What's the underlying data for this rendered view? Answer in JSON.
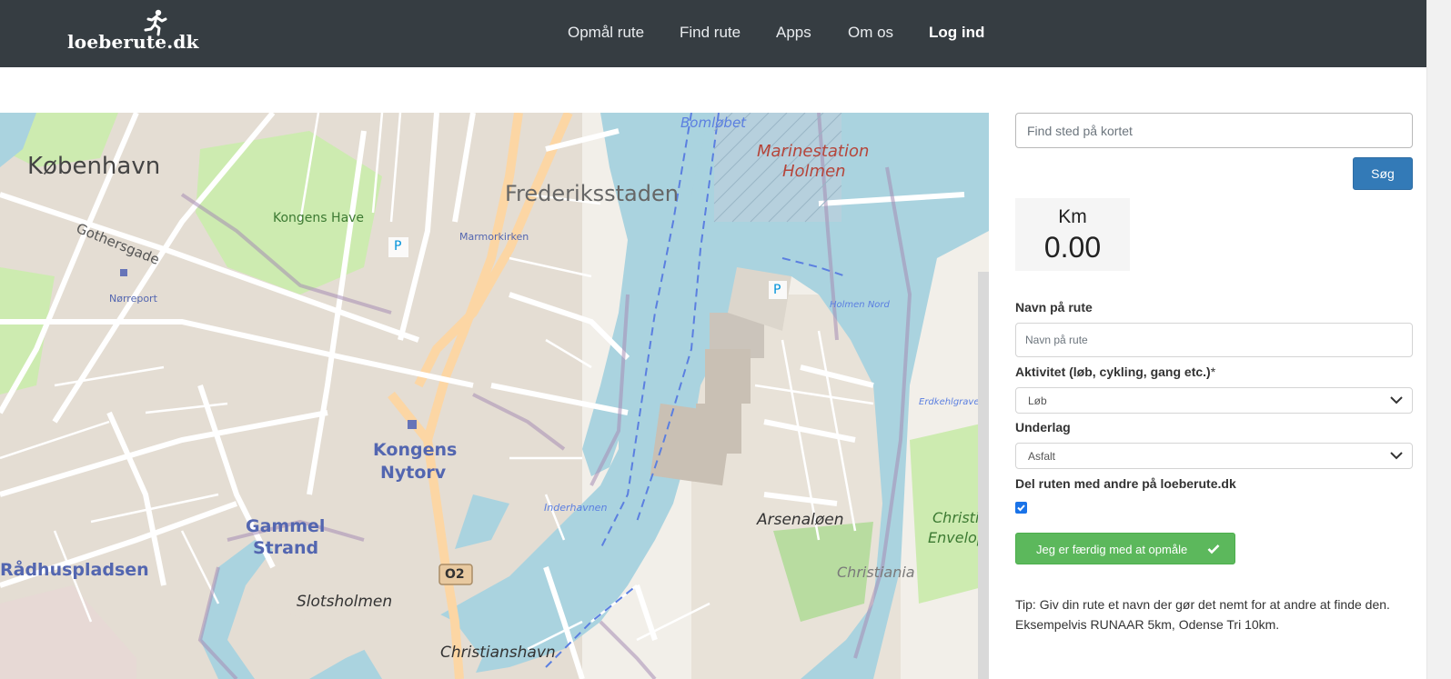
{
  "navbar": {
    "logo_text": "loeberute.dk",
    "logo_icon": "runner-icon",
    "items": [
      {
        "label": "Opmål rute"
      },
      {
        "label": "Find rute"
      },
      {
        "label": "Apps"
      },
      {
        "label": "Om os"
      },
      {
        "label": "Log ind"
      }
    ]
  },
  "map": {
    "labels": [
      "København",
      "Gothersgade",
      "Kongens Have",
      "Nørreport",
      "Marmorkirken",
      "Frederiksstaden",
      "Kongens",
      "Nytorv",
      "Gammel",
      "Strand",
      "Slotsholmen",
      "Christianshavn",
      "Rådhuspladsen",
      "Marinestation",
      "Holmen",
      "Bomløbet",
      "Arsenaløen",
      "Christiania",
      "Christiania",
      "Enveloppen",
      "Inderhavnen",
      "Holmen Nord",
      "Erdkehlgraven",
      "O2",
      "P",
      "P"
    ]
  },
  "search": {
    "placeholder": "Find sted på kortet",
    "button_label": "Søg"
  },
  "distance": {
    "unit_label": "Km",
    "value": "0.00"
  },
  "form": {
    "name_label": "Navn på rute",
    "name_placeholder": "Navn på rute",
    "activity_label": "Aktivitet (løb, cykling, gang etc.)",
    "activity_required": "*",
    "activity_value": "Løb",
    "surface_label": "Underlag",
    "surface_value": "Asfalt",
    "share_label": "Del ruten med andre på loeberute.dk",
    "share_checked": true,
    "done_button_label": "Jeg er færdig med at opmåle",
    "tip": "Tip: Giv din rute et navn der gør det nemt for at andre at finde den. Eksempelvis RUNAAR 5km, Odense Tri 10km."
  },
  "colors": {
    "navbar_bg": "#363d42",
    "primary": "#337ab7",
    "success": "#5cb85c",
    "water": "#aad3df",
    "park": "#c8facc",
    "main_road": "#fcd6a4"
  }
}
